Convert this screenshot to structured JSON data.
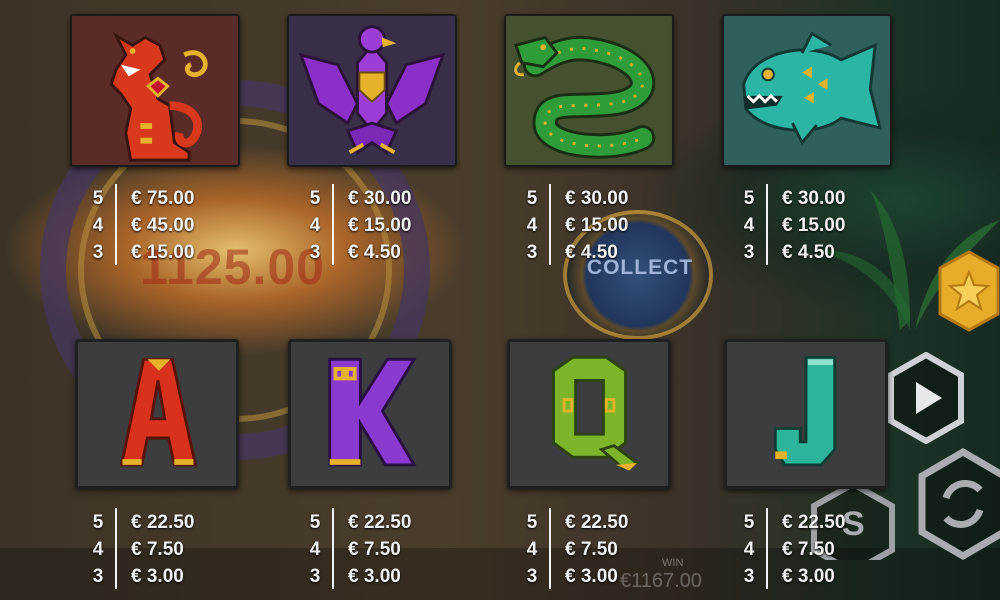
{
  "background": {
    "ghost_win_amount": "1125.00",
    "collect_text": "COLLECT",
    "win_label": "WIN",
    "win_value": "€1167.00"
  },
  "colors": {
    "jaguar": "#d8391c",
    "eagle": "#8b2fc9",
    "serpent": "#2f9c3a",
    "fish": "#2ab5a5",
    "letter_a": "#d8321c",
    "letter_k": "#8b3ad0",
    "letter_q": "#7cb42a",
    "letter_j": "#2db59a",
    "gold": "#e6b22c",
    "text": "#f2f2f2"
  },
  "symbols": [
    {
      "name": "jaguar",
      "icon": "jaguar-icon",
      "payouts": [
        {
          "count": "5",
          "value": "€ 75.00"
        },
        {
          "count": "4",
          "value": "€ 45.00"
        },
        {
          "count": "3",
          "value": "€ 15.00"
        }
      ]
    },
    {
      "name": "eagle",
      "icon": "eagle-icon",
      "payouts": [
        {
          "count": "5",
          "value": "€ 30.00"
        },
        {
          "count": "4",
          "value": "€ 15.00"
        },
        {
          "count": "3",
          "value": "€ 4.50"
        }
      ]
    },
    {
      "name": "serpent",
      "icon": "serpent-icon",
      "payouts": [
        {
          "count": "5",
          "value": "€ 30.00"
        },
        {
          "count": "4",
          "value": "€ 15.00"
        },
        {
          "count": "3",
          "value": "€ 4.50"
        }
      ]
    },
    {
      "name": "fish",
      "icon": "piranha-icon",
      "payouts": [
        {
          "count": "5",
          "value": "€ 30.00"
        },
        {
          "count": "4",
          "value": "€ 15.00"
        },
        {
          "count": "3",
          "value": "€ 4.50"
        }
      ]
    },
    {
      "name": "A",
      "letter": "A",
      "payouts": [
        {
          "count": "5",
          "value": "€ 22.50"
        },
        {
          "count": "4",
          "value": "€ 7.50"
        },
        {
          "count": "3",
          "value": "€ 3.00"
        }
      ]
    },
    {
      "name": "K",
      "letter": "K",
      "payouts": [
        {
          "count": "5",
          "value": "€ 22.50"
        },
        {
          "count": "4",
          "value": "€ 7.50"
        },
        {
          "count": "3",
          "value": "€ 3.00"
        }
      ]
    },
    {
      "name": "Q",
      "letter": "Q",
      "payouts": [
        {
          "count": "5",
          "value": "€ 22.50"
        },
        {
          "count": "4",
          "value": "€ 7.50"
        },
        {
          "count": "3",
          "value": "€ 3.00"
        }
      ]
    },
    {
      "name": "J",
      "letter": "J",
      "payouts": [
        {
          "count": "5",
          "value": "€ 22.50"
        },
        {
          "count": "4",
          "value": "€ 7.50"
        },
        {
          "count": "3",
          "value": "€ 3.00"
        }
      ]
    }
  ],
  "controls": [
    {
      "name": "favorite",
      "icon": "star-icon"
    },
    {
      "name": "play",
      "icon": "play-icon"
    },
    {
      "name": "spin",
      "icon": "spin-arrows-icon"
    },
    {
      "name": "settings",
      "icon": "s-icon"
    }
  ]
}
